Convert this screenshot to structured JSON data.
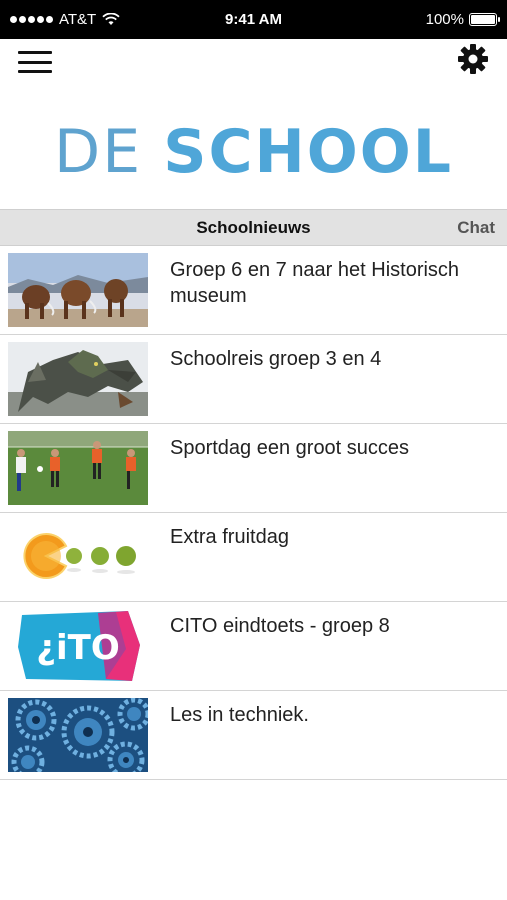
{
  "status_bar": {
    "carrier": "AT&T",
    "time": "9:41 AM",
    "battery": "100%",
    "battery_level": 1.0
  },
  "header": {
    "menu_icon": "hamburger-menu-icon",
    "settings_icon": "gear-icon",
    "logo_de": "DE",
    "logo_school": "SCHOOL"
  },
  "tabs": {
    "active": "Schoolnieuws",
    "chat": "Chat"
  },
  "news": [
    {
      "title": "Groep 6 en 7 naar het Historisch museum",
      "thumbnail": "mammoths-photo"
    },
    {
      "title": "Schoolreis groep 3 en 4",
      "thumbnail": "dragon-photo"
    },
    {
      "title": "Sportdag een groot succes",
      "thumbnail": "soccer-photo"
    },
    {
      "title": "Extra fruitdag",
      "thumbnail": "fruit-pacman-photo"
    },
    {
      "title": "CITO eindtoets - groep 8",
      "thumbnail": "cito-logo"
    },
    {
      "title": "Les in techniek.",
      "thumbnail": "gears-photo"
    }
  ],
  "colors": {
    "logo_blue": "#4fa6d8",
    "tab_bar_bg": "#e2e2e2"
  }
}
